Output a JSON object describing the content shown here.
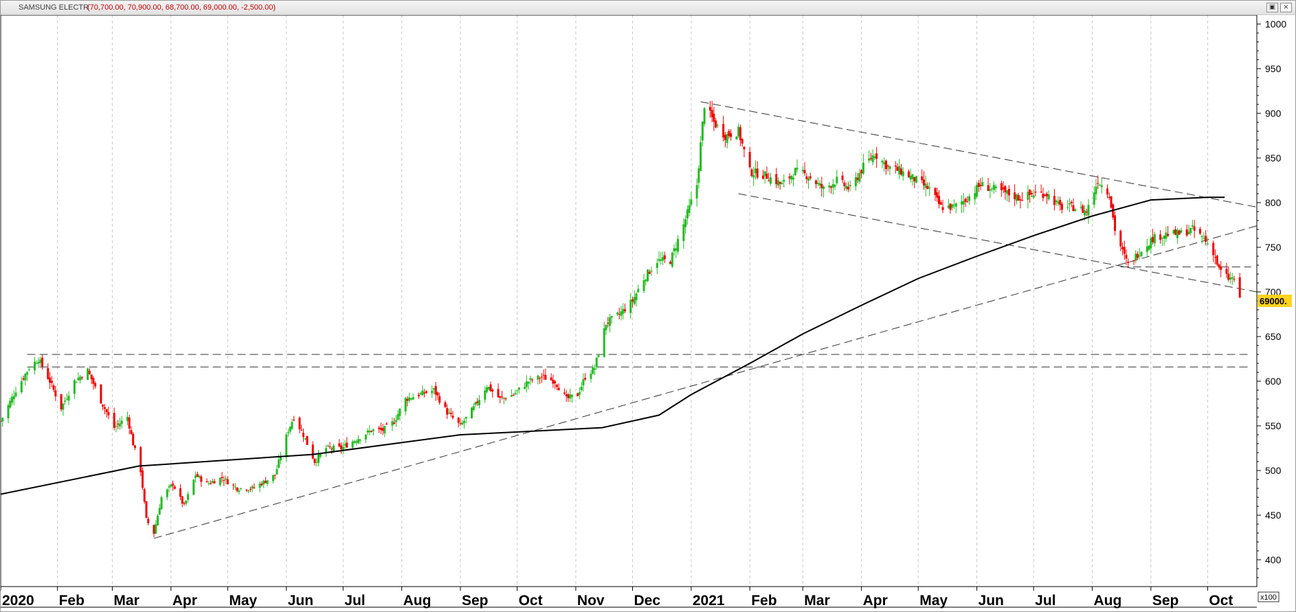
{
  "window": {
    "symbol": "SAMSUNG ELECTR",
    "ohlc_text": "(70,700.00, 70,900.00, 68,700.00, 69,000.00, -2,500.00)",
    "restore_icon": "restore-icon",
    "close_icon": "close-icon"
  },
  "chart_data": {
    "type": "candlestick",
    "ylim": [
      370,
      1010
    ],
    "y_ticks": [
      400,
      450,
      500,
      550,
      600,
      650,
      700,
      750,
      800,
      850,
      900,
      950,
      1000
    ],
    "y_tick_labels": [
      "400",
      "450",
      "500",
      "550",
      "600",
      "650",
      "700",
      "750",
      "800",
      "850",
      "900",
      "950",
      "1000"
    ],
    "y_multiplier_label": "x100",
    "last_price_label": "69000.",
    "x_range": [
      "2020-01-02",
      "2021-10-27"
    ],
    "x_ticks": [
      {
        "date": "2020-01-02",
        "label": "2020",
        "bold": true
      },
      {
        "date": "2020-02-01",
        "label": "Feb",
        "bold": true
      },
      {
        "date": "2020-03-01",
        "label": "Mar",
        "bold": true
      },
      {
        "date": "2020-04-01",
        "label": "Apr",
        "bold": true
      },
      {
        "date": "2020-05-01",
        "label": "May",
        "bold": true
      },
      {
        "date": "2020-06-01",
        "label": "Jun",
        "bold": true
      },
      {
        "date": "2020-07-01",
        "label": "Jul",
        "bold": true
      },
      {
        "date": "2020-08-01",
        "label": "Aug",
        "bold": true
      },
      {
        "date": "2020-09-01",
        "label": "Sep",
        "bold": true
      },
      {
        "date": "2020-10-01",
        "label": "Oct",
        "bold": true
      },
      {
        "date": "2020-11-01",
        "label": "Nov",
        "bold": true
      },
      {
        "date": "2020-12-01",
        "label": "Dec",
        "bold": true
      },
      {
        "date": "2021-01-01",
        "label": "2021",
        "bold": true
      },
      {
        "date": "2021-02-01",
        "label": "Feb",
        "bold": true
      },
      {
        "date": "2021-03-01",
        "label": "Mar",
        "bold": true
      },
      {
        "date": "2021-04-01",
        "label": "Apr",
        "bold": true
      },
      {
        "date": "2021-05-01",
        "label": "May",
        "bold": true
      },
      {
        "date": "2021-06-01",
        "label": "Jun",
        "bold": true
      },
      {
        "date": "2021-07-01",
        "label": "Jul",
        "bold": true
      },
      {
        "date": "2021-08-01",
        "label": "Aug",
        "bold": true
      },
      {
        "date": "2021-09-01",
        "label": "Sep",
        "bold": true
      },
      {
        "date": "2021-10-01",
        "label": "Oct",
        "bold": true
      }
    ],
    "vertical_grid": true,
    "colors": {
      "up": "#22bb22",
      "down": "#ee0000",
      "ma": "#000000",
      "trendline": "#333333",
      "last_price_bg": "#ffd21f"
    },
    "close_path": [
      [
        "2020-01-02",
        555
      ],
      [
        "2020-01-10",
        590
      ],
      [
        "2020-01-17",
        615
      ],
      [
        "2020-01-22",
        625
      ],
      [
        "2020-01-28",
        600
      ],
      [
        "2020-02-03",
        570
      ],
      [
        "2020-02-10",
        600
      ],
      [
        "2020-02-17",
        612
      ],
      [
        "2020-02-24",
        578
      ],
      [
        "2020-03-02",
        548
      ],
      [
        "2020-03-09",
        560
      ],
      [
        "2020-03-12",
        530
      ],
      [
        "2020-03-16",
        500
      ],
      [
        "2020-03-19",
        445
      ],
      [
        "2020-03-23",
        430
      ],
      [
        "2020-03-27",
        470
      ],
      [
        "2020-04-02",
        485
      ],
      [
        "2020-04-08",
        460
      ],
      [
        "2020-04-14",
        495
      ],
      [
        "2020-04-20",
        485
      ],
      [
        "2020-04-28",
        492
      ],
      [
        "2020-05-06",
        480
      ],
      [
        "2020-05-14",
        480
      ],
      [
        "2020-05-20",
        487
      ],
      [
        "2020-05-26",
        495
      ],
      [
        "2020-06-02",
        545
      ],
      [
        "2020-06-05",
        560
      ],
      [
        "2020-06-10",
        540
      ],
      [
        "2020-06-16",
        510
      ],
      [
        "2020-06-22",
        525
      ],
      [
        "2020-06-30",
        525
      ],
      [
        "2020-07-08",
        535
      ],
      [
        "2020-07-16",
        545
      ],
      [
        "2020-07-22",
        545
      ],
      [
        "2020-07-28",
        555
      ],
      [
        "2020-08-03",
        580
      ],
      [
        "2020-08-10",
        585
      ],
      [
        "2020-08-18",
        590
      ],
      [
        "2020-08-25",
        565
      ],
      [
        "2020-09-01",
        550
      ],
      [
        "2020-09-08",
        570
      ],
      [
        "2020-09-15",
        595
      ],
      [
        "2020-09-22",
        580
      ],
      [
        "2020-09-29",
        585
      ],
      [
        "2020-10-07",
        600
      ],
      [
        "2020-10-14",
        605
      ],
      [
        "2020-10-21",
        600
      ],
      [
        "2020-10-27",
        580
      ],
      [
        "2020-11-02",
        585
      ],
      [
        "2020-11-06",
        605
      ],
      [
        "2020-11-11",
        615
      ],
      [
        "2020-11-17",
        665
      ],
      [
        "2020-11-24",
        675
      ],
      [
        "2020-12-01",
        690
      ],
      [
        "2020-12-07",
        715
      ],
      [
        "2020-12-14",
        735
      ],
      [
        "2020-12-21",
        735
      ],
      [
        "2020-12-28",
        775
      ],
      [
        "2021-01-04",
        820
      ],
      [
        "2021-01-08",
        910
      ],
      [
        "2021-01-13",
        890
      ],
      [
        "2021-01-19",
        875
      ],
      [
        "2021-01-26",
        880
      ],
      [
        "2021-02-01",
        835
      ],
      [
        "2021-02-10",
        830
      ],
      [
        "2021-02-18",
        820
      ],
      [
        "2021-02-25",
        835
      ],
      [
        "2021-03-04",
        830
      ],
      [
        "2021-03-12",
        815
      ],
      [
        "2021-03-19",
        825
      ],
      [
        "2021-03-26",
        815
      ],
      [
        "2021-04-02",
        840
      ],
      [
        "2021-04-08",
        855
      ],
      [
        "2021-04-15",
        840
      ],
      [
        "2021-04-22",
        835
      ],
      [
        "2021-04-30",
        825
      ],
      [
        "2021-05-07",
        815
      ],
      [
        "2021-05-13",
        795
      ],
      [
        "2021-05-20",
        795
      ],
      [
        "2021-05-27",
        805
      ],
      [
        "2021-06-03",
        820
      ],
      [
        "2021-06-10",
        815
      ],
      [
        "2021-06-17",
        810
      ],
      [
        "2021-06-24",
        805
      ],
      [
        "2021-07-01",
        810
      ],
      [
        "2021-07-08",
        810
      ],
      [
        "2021-07-15",
        795
      ],
      [
        "2021-07-22",
        795
      ],
      [
        "2021-07-29",
        790
      ],
      [
        "2021-08-04",
        825
      ],
      [
        "2021-08-10",
        810
      ],
      [
        "2021-08-13",
        770
      ],
      [
        "2021-08-17",
        745
      ],
      [
        "2021-08-20",
        730
      ],
      [
        "2021-08-26",
        745
      ],
      [
        "2021-09-02",
        760
      ],
      [
        "2021-09-09",
        765
      ],
      [
        "2021-09-16",
        765
      ],
      [
        "2021-09-23",
        770
      ],
      [
        "2021-09-29",
        760
      ],
      [
        "2021-10-04",
        745
      ],
      [
        "2021-10-07",
        725
      ],
      [
        "2021-10-12",
        715
      ],
      [
        "2021-10-15",
        715
      ],
      [
        "2021-10-18",
        690
      ]
    ],
    "moving_average": [
      [
        "2020-01-01",
        473
      ],
      [
        "2020-03-15",
        505
      ],
      [
        "2020-06-15",
        518
      ],
      [
        "2020-09-01",
        540
      ],
      [
        "2020-11-15",
        548
      ],
      [
        "2020-12-15",
        562
      ],
      [
        "2021-01-01",
        585
      ],
      [
        "2021-02-01",
        620
      ],
      [
        "2021-03-01",
        653
      ],
      [
        "2021-04-01",
        685
      ],
      [
        "2021-05-01",
        715
      ],
      [
        "2021-06-01",
        740
      ],
      [
        "2021-07-01",
        763
      ],
      [
        "2021-08-01",
        785
      ],
      [
        "2021-09-01",
        803
      ],
      [
        "2021-10-01",
        806
      ],
      [
        "2021-10-10",
        806
      ]
    ],
    "trendlines": [
      {
        "name": "upper-channel",
        "from": [
          "2021-01-06",
          913
        ],
        "to": [
          "2021-10-27",
          795
        ],
        "style": "dashed"
      },
      {
        "name": "lower-channel",
        "from": [
          "2021-01-26",
          810
        ],
        "to": [
          "2021-10-27",
          700
        ],
        "style": "dashed"
      },
      {
        "name": "rising-support",
        "from": [
          "2020-03-23",
          424
        ],
        "to": [
          "2021-10-27",
          774
        ],
        "style": "dashed"
      },
      {
        "name": "resistance-zone-top",
        "from": [
          "2020-01-16",
          630
        ],
        "to": [
          "2021-10-24",
          630
        ],
        "style": "dashed"
      },
      {
        "name": "resistance-zone-bottom",
        "from": [
          "2020-01-16",
          616
        ],
        "to": [
          "2021-10-24",
          616
        ],
        "style": "dashed"
      },
      {
        "name": "gap-level",
        "from": [
          "2021-08-16",
          728
        ],
        "to": [
          "2021-10-24",
          728
        ],
        "style": "dashed"
      }
    ]
  }
}
